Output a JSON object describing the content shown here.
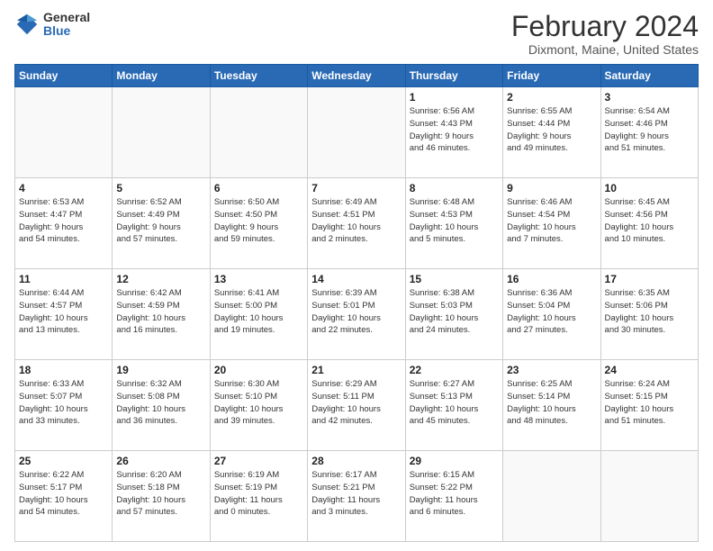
{
  "header": {
    "logo_general": "General",
    "logo_blue": "Blue",
    "title": "February 2024",
    "subtitle": "Dixmont, Maine, United States"
  },
  "days_of_week": [
    "Sunday",
    "Monday",
    "Tuesday",
    "Wednesday",
    "Thursday",
    "Friday",
    "Saturday"
  ],
  "weeks": [
    [
      {
        "day": "",
        "info": ""
      },
      {
        "day": "",
        "info": ""
      },
      {
        "day": "",
        "info": ""
      },
      {
        "day": "",
        "info": ""
      },
      {
        "day": "1",
        "info": "Sunrise: 6:56 AM\nSunset: 4:43 PM\nDaylight: 9 hours\nand 46 minutes."
      },
      {
        "day": "2",
        "info": "Sunrise: 6:55 AM\nSunset: 4:44 PM\nDaylight: 9 hours\nand 49 minutes."
      },
      {
        "day": "3",
        "info": "Sunrise: 6:54 AM\nSunset: 4:46 PM\nDaylight: 9 hours\nand 51 minutes."
      }
    ],
    [
      {
        "day": "4",
        "info": "Sunrise: 6:53 AM\nSunset: 4:47 PM\nDaylight: 9 hours\nand 54 minutes."
      },
      {
        "day": "5",
        "info": "Sunrise: 6:52 AM\nSunset: 4:49 PM\nDaylight: 9 hours\nand 57 minutes."
      },
      {
        "day": "6",
        "info": "Sunrise: 6:50 AM\nSunset: 4:50 PM\nDaylight: 9 hours\nand 59 minutes."
      },
      {
        "day": "7",
        "info": "Sunrise: 6:49 AM\nSunset: 4:51 PM\nDaylight: 10 hours\nand 2 minutes."
      },
      {
        "day": "8",
        "info": "Sunrise: 6:48 AM\nSunset: 4:53 PM\nDaylight: 10 hours\nand 5 minutes."
      },
      {
        "day": "9",
        "info": "Sunrise: 6:46 AM\nSunset: 4:54 PM\nDaylight: 10 hours\nand 7 minutes."
      },
      {
        "day": "10",
        "info": "Sunrise: 6:45 AM\nSunset: 4:56 PM\nDaylight: 10 hours\nand 10 minutes."
      }
    ],
    [
      {
        "day": "11",
        "info": "Sunrise: 6:44 AM\nSunset: 4:57 PM\nDaylight: 10 hours\nand 13 minutes."
      },
      {
        "day": "12",
        "info": "Sunrise: 6:42 AM\nSunset: 4:59 PM\nDaylight: 10 hours\nand 16 minutes."
      },
      {
        "day": "13",
        "info": "Sunrise: 6:41 AM\nSunset: 5:00 PM\nDaylight: 10 hours\nand 19 minutes."
      },
      {
        "day": "14",
        "info": "Sunrise: 6:39 AM\nSunset: 5:01 PM\nDaylight: 10 hours\nand 22 minutes."
      },
      {
        "day": "15",
        "info": "Sunrise: 6:38 AM\nSunset: 5:03 PM\nDaylight: 10 hours\nand 24 minutes."
      },
      {
        "day": "16",
        "info": "Sunrise: 6:36 AM\nSunset: 5:04 PM\nDaylight: 10 hours\nand 27 minutes."
      },
      {
        "day": "17",
        "info": "Sunrise: 6:35 AM\nSunset: 5:06 PM\nDaylight: 10 hours\nand 30 minutes."
      }
    ],
    [
      {
        "day": "18",
        "info": "Sunrise: 6:33 AM\nSunset: 5:07 PM\nDaylight: 10 hours\nand 33 minutes."
      },
      {
        "day": "19",
        "info": "Sunrise: 6:32 AM\nSunset: 5:08 PM\nDaylight: 10 hours\nand 36 minutes."
      },
      {
        "day": "20",
        "info": "Sunrise: 6:30 AM\nSunset: 5:10 PM\nDaylight: 10 hours\nand 39 minutes."
      },
      {
        "day": "21",
        "info": "Sunrise: 6:29 AM\nSunset: 5:11 PM\nDaylight: 10 hours\nand 42 minutes."
      },
      {
        "day": "22",
        "info": "Sunrise: 6:27 AM\nSunset: 5:13 PM\nDaylight: 10 hours\nand 45 minutes."
      },
      {
        "day": "23",
        "info": "Sunrise: 6:25 AM\nSunset: 5:14 PM\nDaylight: 10 hours\nand 48 minutes."
      },
      {
        "day": "24",
        "info": "Sunrise: 6:24 AM\nSunset: 5:15 PM\nDaylight: 10 hours\nand 51 minutes."
      }
    ],
    [
      {
        "day": "25",
        "info": "Sunrise: 6:22 AM\nSunset: 5:17 PM\nDaylight: 10 hours\nand 54 minutes."
      },
      {
        "day": "26",
        "info": "Sunrise: 6:20 AM\nSunset: 5:18 PM\nDaylight: 10 hours\nand 57 minutes."
      },
      {
        "day": "27",
        "info": "Sunrise: 6:19 AM\nSunset: 5:19 PM\nDaylight: 11 hours\nand 0 minutes."
      },
      {
        "day": "28",
        "info": "Sunrise: 6:17 AM\nSunset: 5:21 PM\nDaylight: 11 hours\nand 3 minutes."
      },
      {
        "day": "29",
        "info": "Sunrise: 6:15 AM\nSunset: 5:22 PM\nDaylight: 11 hours\nand 6 minutes."
      },
      {
        "day": "",
        "info": ""
      },
      {
        "day": "",
        "info": ""
      }
    ]
  ]
}
